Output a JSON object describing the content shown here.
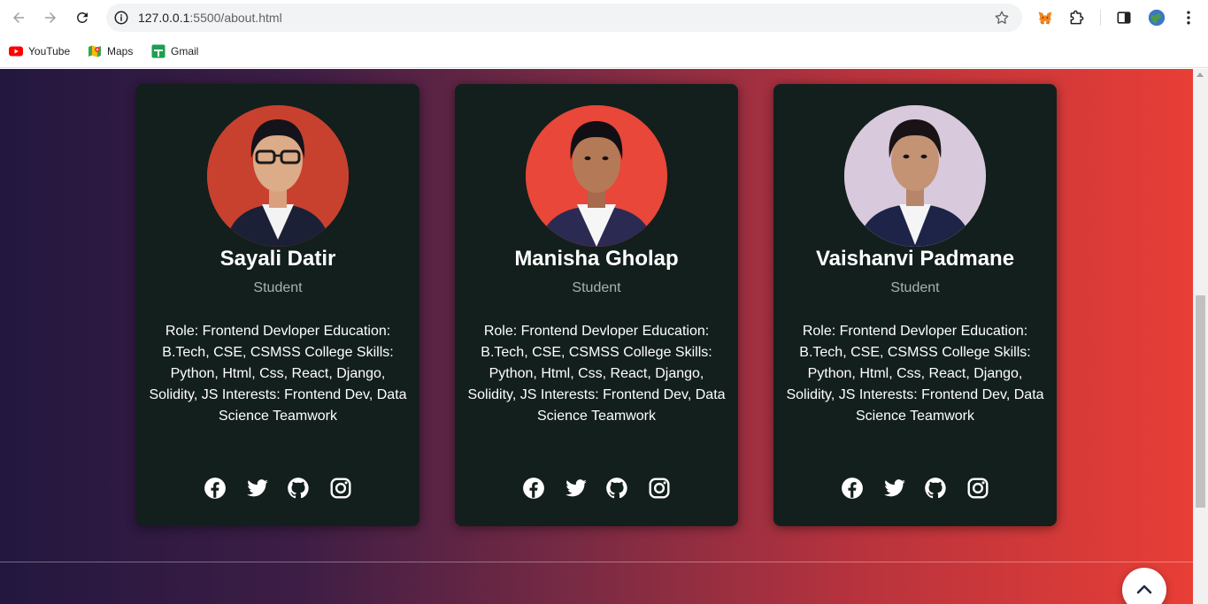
{
  "browser": {
    "url_host": "127.0.0.1",
    "url_path": ":5500/about.html",
    "bookmarks": [
      {
        "label": "YouTube"
      },
      {
        "label": "Maps"
      },
      {
        "label": "Gmail"
      }
    ]
  },
  "team": [
    {
      "name": "Sayali Datir",
      "role": "Student",
      "description": "Role: Frontend Devloper Education: B.Tech, CSE, CSMSS College Skills: Python, Html, Css, React, Django, Solidity, JS Interests: Frontend Dev, Data Science Teamwork",
      "photo_bg": "#c8412f"
    },
    {
      "name": "Manisha Gholap",
      "role": "Student",
      "description": "Role: Frontend Devloper Education: B.Tech, CSE, CSMSS College Skills: Python, Html, Css, React, Django, Solidity, JS Interests: Frontend Dev, Data Science Teamwork",
      "photo_bg": "#e8473a"
    },
    {
      "name": "Vaishanvi Padmane",
      "role": "Student",
      "description": "Role: Frontend Devloper Education: B.Tech, CSE, CSMSS College Skills: Python, Html, Css, React, Django, Solidity, JS Interests: Frontend Dev, Data Science Teamwork",
      "photo_bg": "#d9c9dc"
    }
  ],
  "social_icons": [
    "facebook-icon",
    "twitter-icon",
    "github-icon",
    "instagram-icon"
  ],
  "colors": {
    "card_bg": "#131f1c",
    "gradient_start": "#23173f",
    "gradient_end": "#e83e36"
  }
}
